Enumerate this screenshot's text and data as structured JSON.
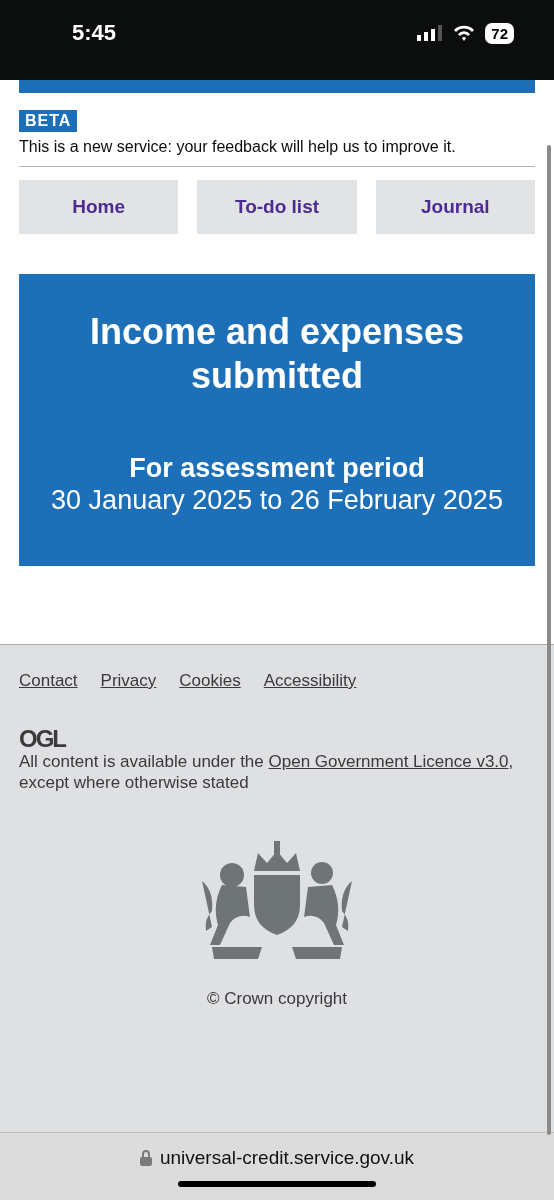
{
  "status_bar": {
    "time": "5:45",
    "battery": "72"
  },
  "phase_banner": {
    "tag": "BETA",
    "text": "This is a new service: your feedback will help us to improve it."
  },
  "nav": [
    {
      "label": "Home"
    },
    {
      "label": "To-do list"
    },
    {
      "label": "Journal"
    }
  ],
  "panel": {
    "title": "Income and expenses submitted",
    "subtitle": "For assessment period",
    "period": "30 January 2025 to 26 February 2025"
  },
  "footer": {
    "links": [
      {
        "label": "Contact"
      },
      {
        "label": "Privacy"
      },
      {
        "label": "Cookies"
      },
      {
        "label": "Accessibility"
      }
    ],
    "logo": "OGL",
    "licence_before": "All content is available under the ",
    "licence_link": "Open Government Licence v3.0",
    "licence_after": ", except where otherwise stated",
    "copyright": "© Crown copyright"
  },
  "address_bar": {
    "url": "universal-credit.service.gov.uk"
  }
}
